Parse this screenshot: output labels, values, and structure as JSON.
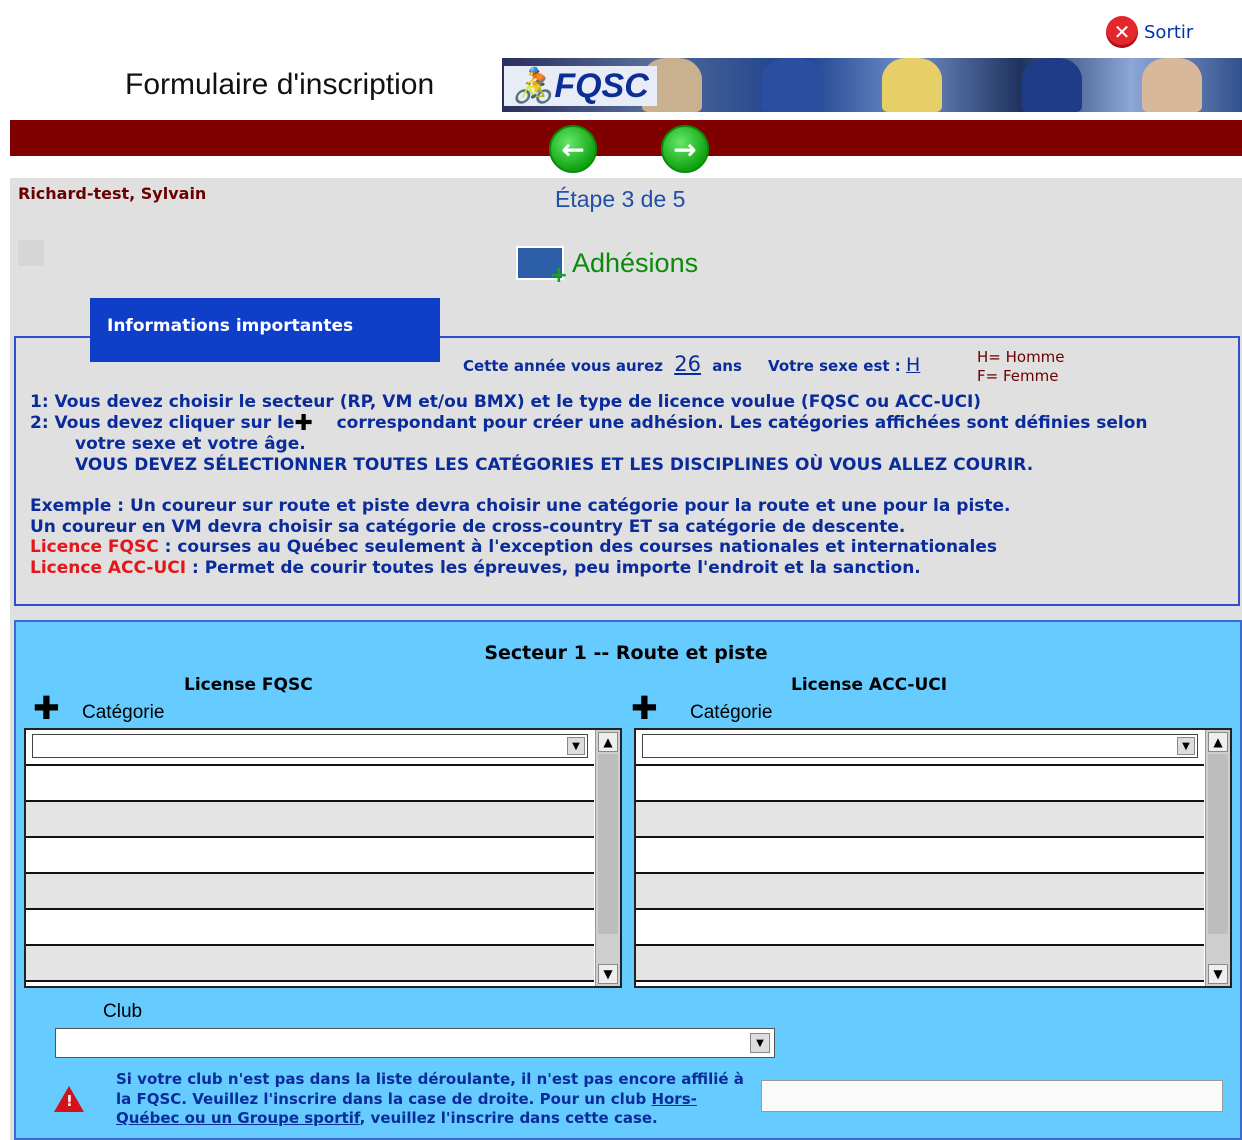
{
  "header": {
    "sortir_label": "Sortir",
    "form_title": "Formulaire d'inscription",
    "banner_logo": "FQSC"
  },
  "nav": {
    "prev_icon": "arrow-left-icon",
    "next_icon": "arrow-right-icon"
  },
  "user": {
    "name": "Richard-test, Sylvain"
  },
  "step": {
    "label": "Étape 3 de 5"
  },
  "section": {
    "title": "Adhésions",
    "icon": "membership-card-icon"
  },
  "info": {
    "tab_title": "Informations importantes",
    "age_prefix": "Cette année vous aurez",
    "age_value": "26",
    "age_suffix": "ans",
    "sex_prefix": "Votre sexe est :",
    "sex_value": "H",
    "legend_h": "H= Homme",
    "legend_f": "F= Femme",
    "line1": "1: Vous devez choisir le secteur (RP, VM et/ou BMX) et le type de licence voulue (FQSC ou ACC-UCI)",
    "line2a": "2: Vous devez cliquer sur le",
    "line2b": "correspondant pour créer une adhésion. Les catégories affichées sont définies selon",
    "line3": "votre sexe et votre âge.",
    "line4": "VOUS DEVEZ SÉLECTIONNER TOUTES LES CATÉGORIES ET LES DISCIPLINES OÙ VOUS ALLEZ COURIR.",
    "line5": "Exemple : Un coureur sur route et piste devra choisir une catégorie pour la route et une pour la piste.",
    "line6": "Un coureur en VM devra choisir sa catégorie de cross-country ET sa catégorie de descente.",
    "lic_fqsc_label": "Licence FQSC",
    "lic_fqsc_text": " : courses au Québec seulement à l'exception des courses nationales et internationales",
    "lic_acc_label": "Licence ACC-UCI",
    "lic_acc_text": " : Permet de courir toutes les épreuves, peu importe l'endroit et la sanction."
  },
  "secteur": {
    "title": "Secteur 1 -- Route et piste",
    "fqsc": {
      "title": "License FQSC",
      "category_label": "Catégorie",
      "selected": ""
    },
    "acc": {
      "title": "License ACC-UCI",
      "category_label": "Catégorie",
      "selected": ""
    }
  },
  "club": {
    "label": "Club",
    "selected": "",
    "note_1": "Si votre club n'est pas dans la liste déroulante, il n'est pas encore affilié à la FQSC. Veuillez l'inscrire dans la case de droite. Pour un club ",
    "note_link": "Hors-Québec ou un Groupe sportif",
    "note_2": ", veuillez l'inscrire dans cette case.",
    "other_value": ""
  }
}
